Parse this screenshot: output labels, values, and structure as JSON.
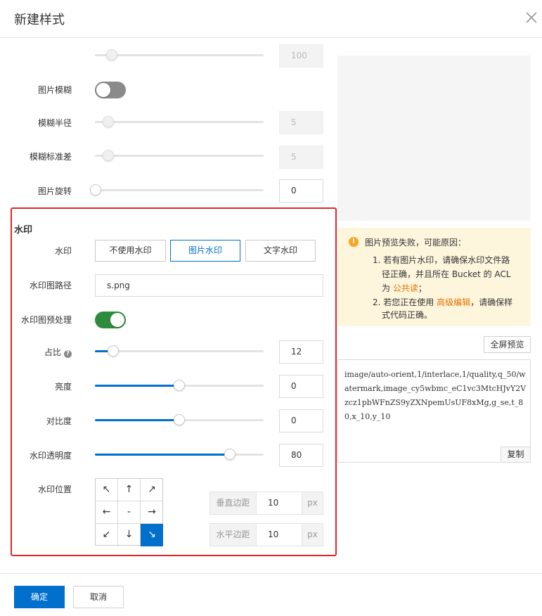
{
  "dialog": {
    "title": "新建样式"
  },
  "quality": {
    "slider_fraction": 0.1,
    "value": "100"
  },
  "blur": {
    "label": "图片模糊",
    "enabled": false,
    "radius": {
      "label": "模糊半径",
      "value": "5",
      "slider_fraction": 0.08
    },
    "sigma": {
      "label": "模糊标准差",
      "value": "5",
      "slider_fraction": 0.08
    }
  },
  "rotate": {
    "label": "图片旋转",
    "value": "0",
    "slider_fraction": 0
  },
  "watermark": {
    "section_title": "水印",
    "type_label": "水印",
    "options": [
      "不使用水印",
      "图片水印",
      "文字水印"
    ],
    "selected_option": "图片水印",
    "path_label": "水印图路径",
    "path_value": "s.png",
    "preprocess_label": "水印图预处理",
    "preprocess_enabled": true,
    "ratio": {
      "label": "占比",
      "help_icon": "question-circle-icon",
      "value": "12",
      "slider_fraction": 0.11
    },
    "brightness": {
      "label": "亮度",
      "value": "0",
      "slider_fraction": 0.5
    },
    "contrast": {
      "label": "对比度",
      "value": "0",
      "slider_fraction": 0.5
    },
    "opacity": {
      "label": "水印透明度",
      "value": "80",
      "slider_fraction": 0.8
    },
    "position": {
      "label": "水印位置",
      "cells": [
        "↖",
        "↑",
        "↗",
        "←",
        "-",
        "→",
        "↙",
        "↓",
        "↘"
      ],
      "selected": "↘"
    },
    "vertical_margin": {
      "label": "垂直边距",
      "value": "10",
      "unit": "px"
    },
    "horizontal_margin": {
      "label": "水平边距",
      "value": "10",
      "unit": "px"
    }
  },
  "preview": {
    "warning_icon": "exclamation-circle-icon",
    "warning_title": "图片预览失败，可能原因：",
    "reason1_line1": "1. 若有图片水印，请确保水印文件路",
    "reason1_line2": "径正确，并且所在 Bucket 的 ACL",
    "reason1_prefix": "为 ",
    "reason1_link": "公共读",
    "reason1_suffix": "；",
    "reason2_prefix": "2. 若您正在使用 ",
    "reason2_link": "高级编辑",
    "reason2_suffix": "，请确保样",
    "reason2_line2": "式代码正确。",
    "fullscreen_label": "全屏预览",
    "code": "image/auto-orient,1/interlace,1/quality,q_50/watermark,image_cy5wbmc_eC1vc3MtcHJvY2Vzcz1pbWFnZS9yZXNpemUsUF8xMg,g_se,t_80,x_10,y_10",
    "copy_label": "复制"
  },
  "footer": {
    "confirm_label": "确定",
    "cancel_label": "取消"
  },
  "colors": {
    "primary": "#0070cc",
    "toggle_on": "#2d8c3c",
    "highlight_border": "#e0262b",
    "warning_bg": "#fef5dd",
    "link": "#e67300"
  }
}
